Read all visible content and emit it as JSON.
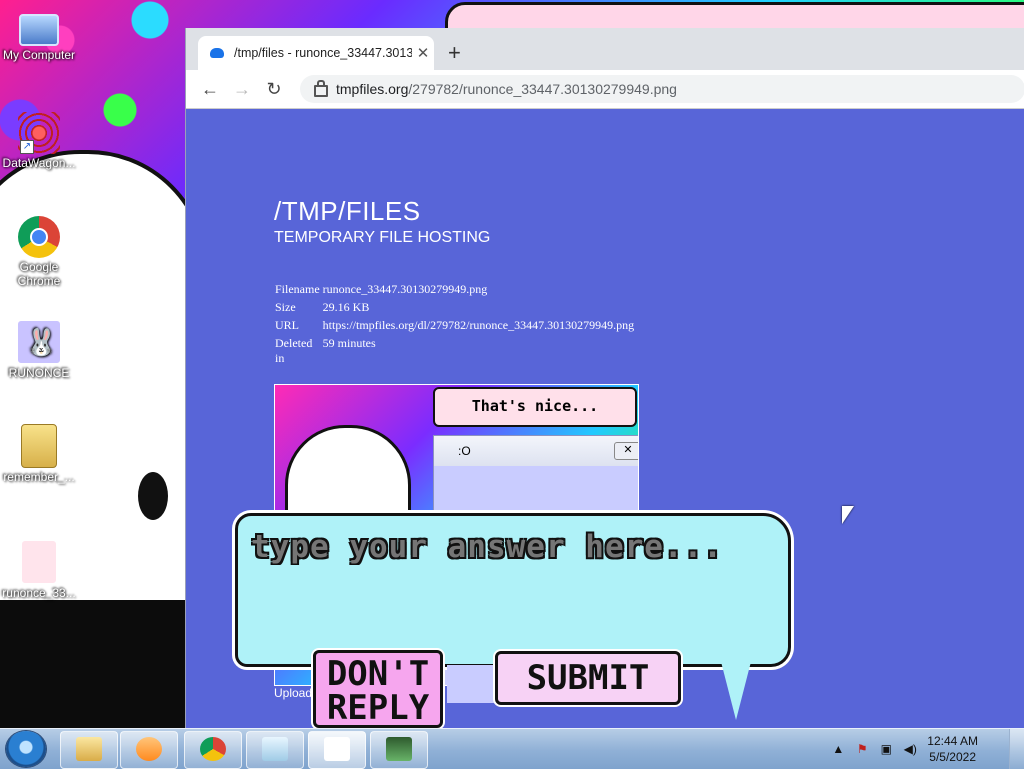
{
  "desktop": {
    "icons": [
      {
        "label": "My Computer"
      },
      {
        "label": "DataWagon..."
      },
      {
        "label": "Google Chrome"
      },
      {
        "label": "RUNONCE"
      },
      {
        "label": "remember_..."
      },
      {
        "label": "runonce_33..."
      }
    ]
  },
  "browser": {
    "tab_title": "/tmp/files - runonce_33447.3013",
    "url_host": "tmpfiles.org",
    "url_path": "/279782/runonce_33447.30130279949.png"
  },
  "page": {
    "title": "/TMP/FILES",
    "subtitle": "TEMPORARY FILE HOSTING",
    "meta": [
      {
        "key": "Filename",
        "value": "runonce_33447.30130279949.png"
      },
      {
        "key": "Size",
        "value": "29.16 KB"
      },
      {
        "key": "URL",
        "value": "https://tmpfiles.org/dl/279782/runonce_33447.30130279949.png"
      },
      {
        "key": "Deleted in",
        "value": "59 minutes"
      }
    ],
    "upload_link": "Upload",
    "preview": {
      "bubble_text": "That's nice...",
      "window_title": ":O",
      "close_glyph": "✕"
    }
  },
  "popup": {
    "placeholder": "type your answer here...",
    "dont_reply_label": "DON'T REPLY",
    "submit_label": "SUBMIT"
  },
  "taskbar": {
    "time": "12:44 AM",
    "date": "5/5/2022"
  }
}
